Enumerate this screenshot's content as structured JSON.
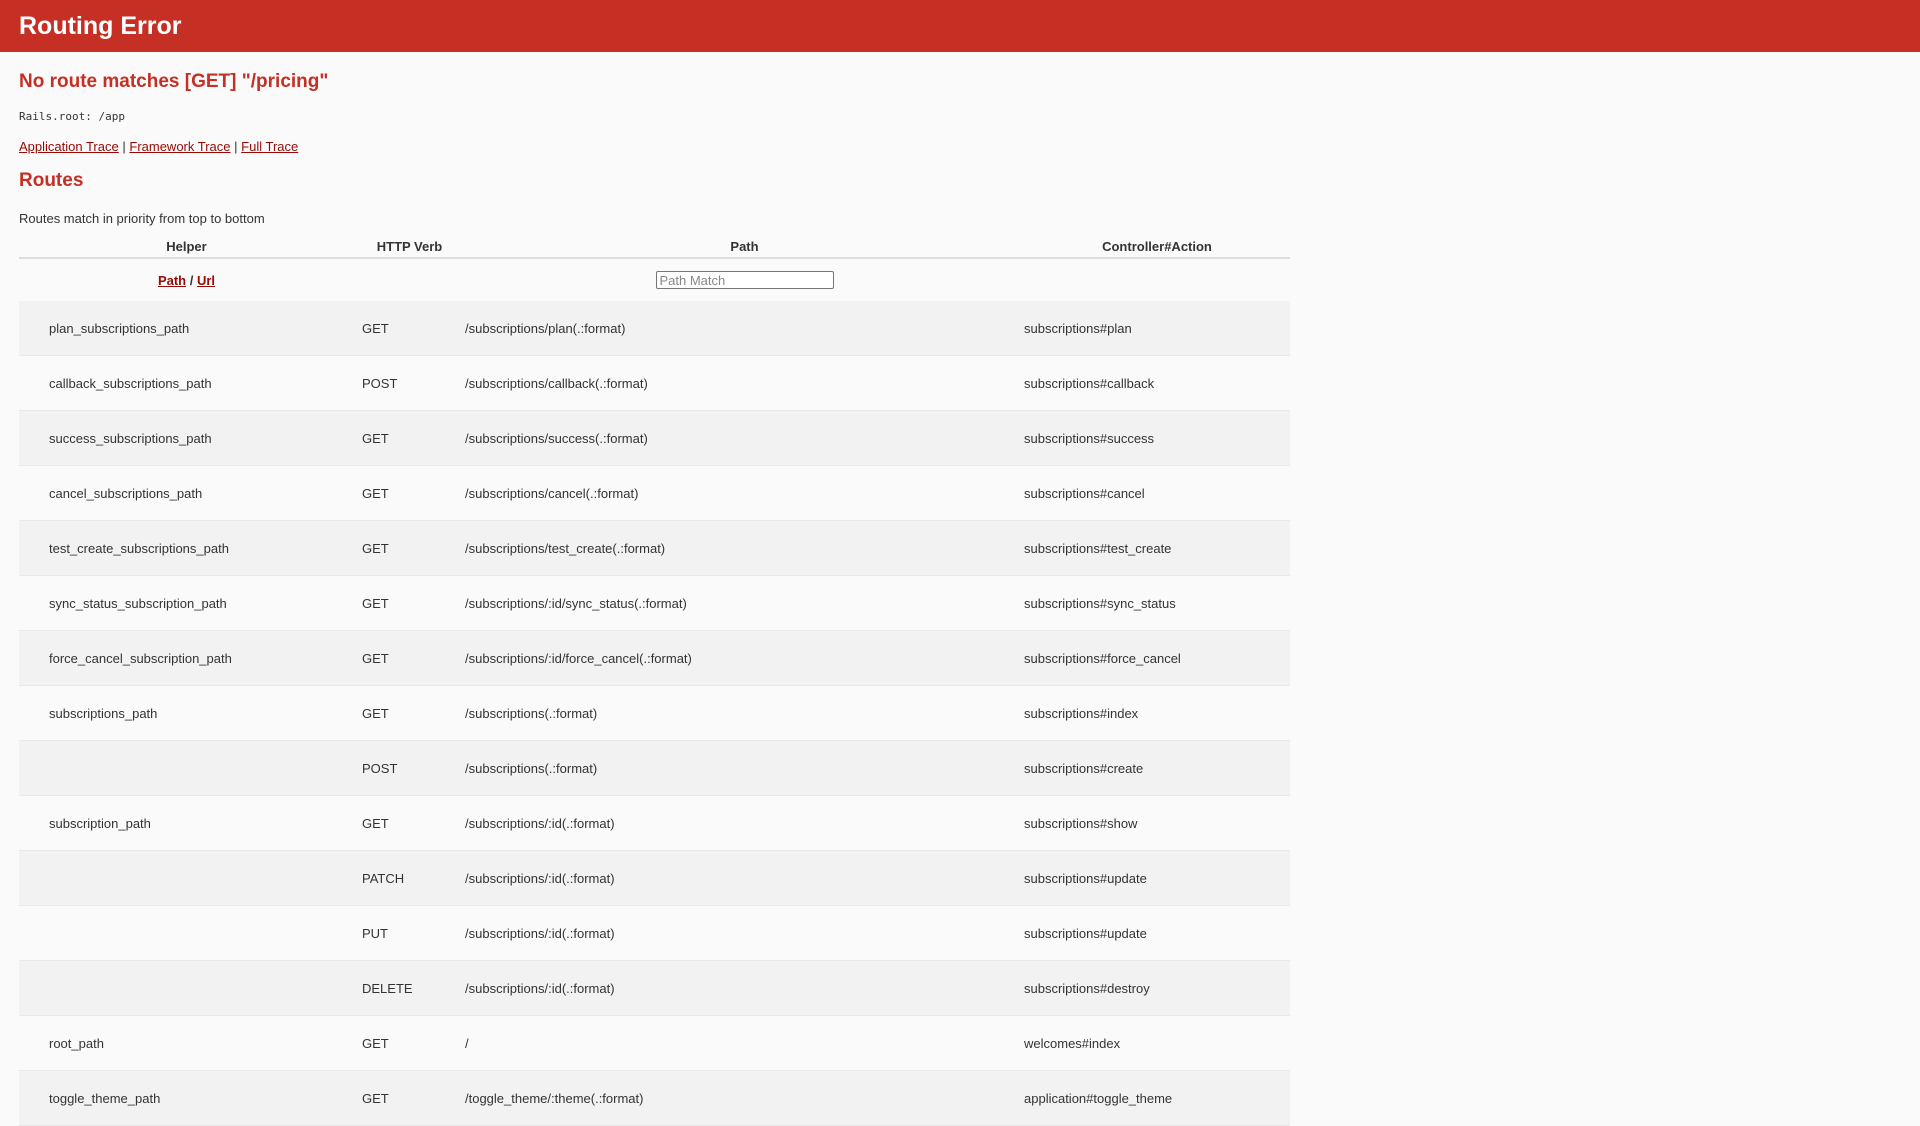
{
  "header": {
    "title": "Routing Error"
  },
  "error": {
    "message": "No route matches [GET] \"/pricing\""
  },
  "rails_root": "Rails.root: /app",
  "traces": {
    "application": "Application Trace",
    "separator": "|",
    "framework": "Framework Trace",
    "full": "Full Trace"
  },
  "routes": {
    "heading": "Routes",
    "note": "Routes match in priority from top to bottom",
    "columns": {
      "helper": "Helper",
      "verb": "HTTP Verb",
      "path": "Path",
      "action": "Controller#Action"
    },
    "filter": {
      "path_link": "Path",
      "separator": "/",
      "url_link": "Url",
      "placeholder": "Path Match"
    },
    "rows": [
      {
        "helper": "plan_subscriptions_path",
        "verb": "GET",
        "path": "/subscriptions/plan(.:format)",
        "action": "subscriptions#plan"
      },
      {
        "helper": "callback_subscriptions_path",
        "verb": "POST",
        "path": "/subscriptions/callback(.:format)",
        "action": "subscriptions#callback"
      },
      {
        "helper": "success_subscriptions_path",
        "verb": "GET",
        "path": "/subscriptions/success(.:format)",
        "action": "subscriptions#success"
      },
      {
        "helper": "cancel_subscriptions_path",
        "verb": "GET",
        "path": "/subscriptions/cancel(.:format)",
        "action": "subscriptions#cancel"
      },
      {
        "helper": "test_create_subscriptions_path",
        "verb": "GET",
        "path": "/subscriptions/test_create(.:format)",
        "action": "subscriptions#test_create"
      },
      {
        "helper": "sync_status_subscription_path",
        "verb": "GET",
        "path": "/subscriptions/:id/sync_status(.:format)",
        "action": "subscriptions#sync_status"
      },
      {
        "helper": "force_cancel_subscription_path",
        "verb": "GET",
        "path": "/subscriptions/:id/force_cancel(.:format)",
        "action": "subscriptions#force_cancel"
      },
      {
        "helper": "subscriptions_path",
        "verb": "GET",
        "path": "/subscriptions(.:format)",
        "action": "subscriptions#index"
      },
      {
        "helper": "",
        "verb": "POST",
        "path": "/subscriptions(.:format)",
        "action": "subscriptions#create"
      },
      {
        "helper": "subscription_path",
        "verb": "GET",
        "path": "/subscriptions/:id(.:format)",
        "action": "subscriptions#show"
      },
      {
        "helper": "",
        "verb": "PATCH",
        "path": "/subscriptions/:id(.:format)",
        "action": "subscriptions#update"
      },
      {
        "helper": "",
        "verb": "PUT",
        "path": "/subscriptions/:id(.:format)",
        "action": "subscriptions#update"
      },
      {
        "helper": "",
        "verb": "DELETE",
        "path": "/subscriptions/:id(.:format)",
        "action": "subscriptions#destroy"
      },
      {
        "helper": "root_path",
        "verb": "GET",
        "path": "/",
        "action": "welcomes#index"
      },
      {
        "helper": "toggle_theme_path",
        "verb": "GET",
        "path": "/toggle_theme/:theme(.:format)",
        "action": "application#toggle_theme"
      }
    ]
  }
}
